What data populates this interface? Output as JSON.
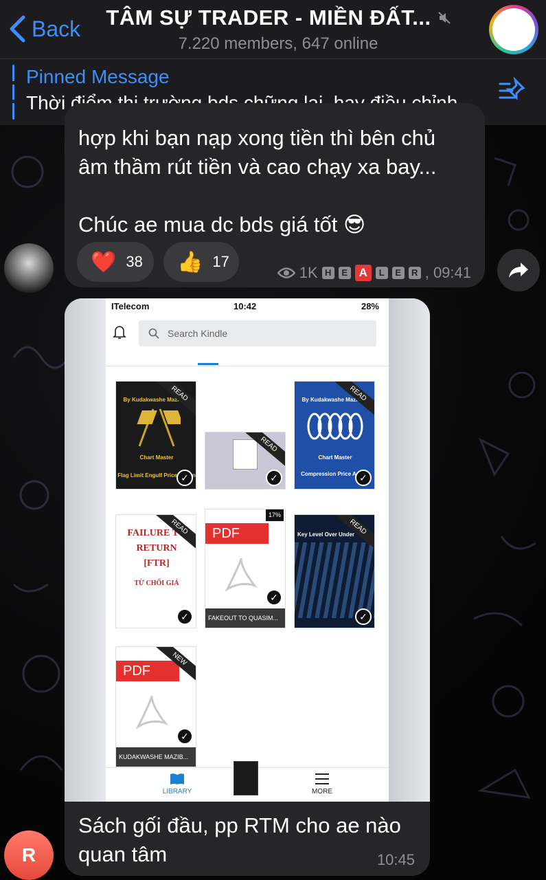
{
  "header": {
    "back_label": "Back",
    "title": "TÂM SỰ TRADER - MIỀN ĐẤT...",
    "subtitle": "7.220 members, 647 online"
  },
  "pinned": {
    "title": "Pinned Message",
    "text": "Thời điểm thị trường bds chững lại, hay điều chỉnh..."
  },
  "message1": {
    "line1": "hợp khi bạn nạp xong tiền thì bên chủ",
    "line2": "âm thầm rút tiền và cao chạy xa bay...",
    "line3": "Chúc ae mua dc bds giá tốt 😎",
    "reactions": [
      {
        "emoji": "❤️",
        "count": "38"
      },
      {
        "emoji": "👍",
        "count": "17"
      }
    ],
    "views": "1K",
    "signature_letters": [
      "H",
      "E",
      "A",
      "L",
      "E",
      "R"
    ],
    "time": ", 09:41"
  },
  "message2": {
    "screenshot": {
      "carrier": "ITelecom",
      "clock": "10:42",
      "battery": "28%",
      "search_placeholder": "Search Kindle",
      "books": [
        {
          "title_top": "By Kudakwashe Mazibisa",
          "title_mid": "Chart Master",
          "title_bottom": "Flag Limit Engulf Price Action",
          "badge": "READ"
        },
        {
          "badge": "READ"
        },
        {
          "title_top": "By Kudakwashe Mazibisa",
          "title_mid": "Chart Master",
          "title_bottom": "Compression Price Action",
          "badge": "READ"
        },
        {
          "line1": "FAILURE TO",
          "line2": "RETURN",
          "line3": "[FTR]",
          "sub": "TỪ CHỐI GIÁ",
          "badge": "READ"
        },
        {
          "pdf": "PDF",
          "caption": "FAKEOUT TO QUASIM...",
          "progress": "17%"
        },
        {
          "title_top": "Key Level Over Under",
          "badge": "READ"
        },
        {
          "pdf": "PDF",
          "caption": "KUDAKWASHE MAZIB...",
          "badge": "NEW"
        }
      ],
      "nav": {
        "library": "LIBRARY",
        "more": "MORE"
      }
    },
    "caption_line1": "Sách gối đầu, pp RTM cho ae nào",
    "caption_line2": "quan tâm",
    "time": "10:45"
  },
  "avatar_initial": "R",
  "colors": {
    "accent": "#3e8ef7",
    "bubble": "#262628",
    "header": "#1c1c1e"
  }
}
